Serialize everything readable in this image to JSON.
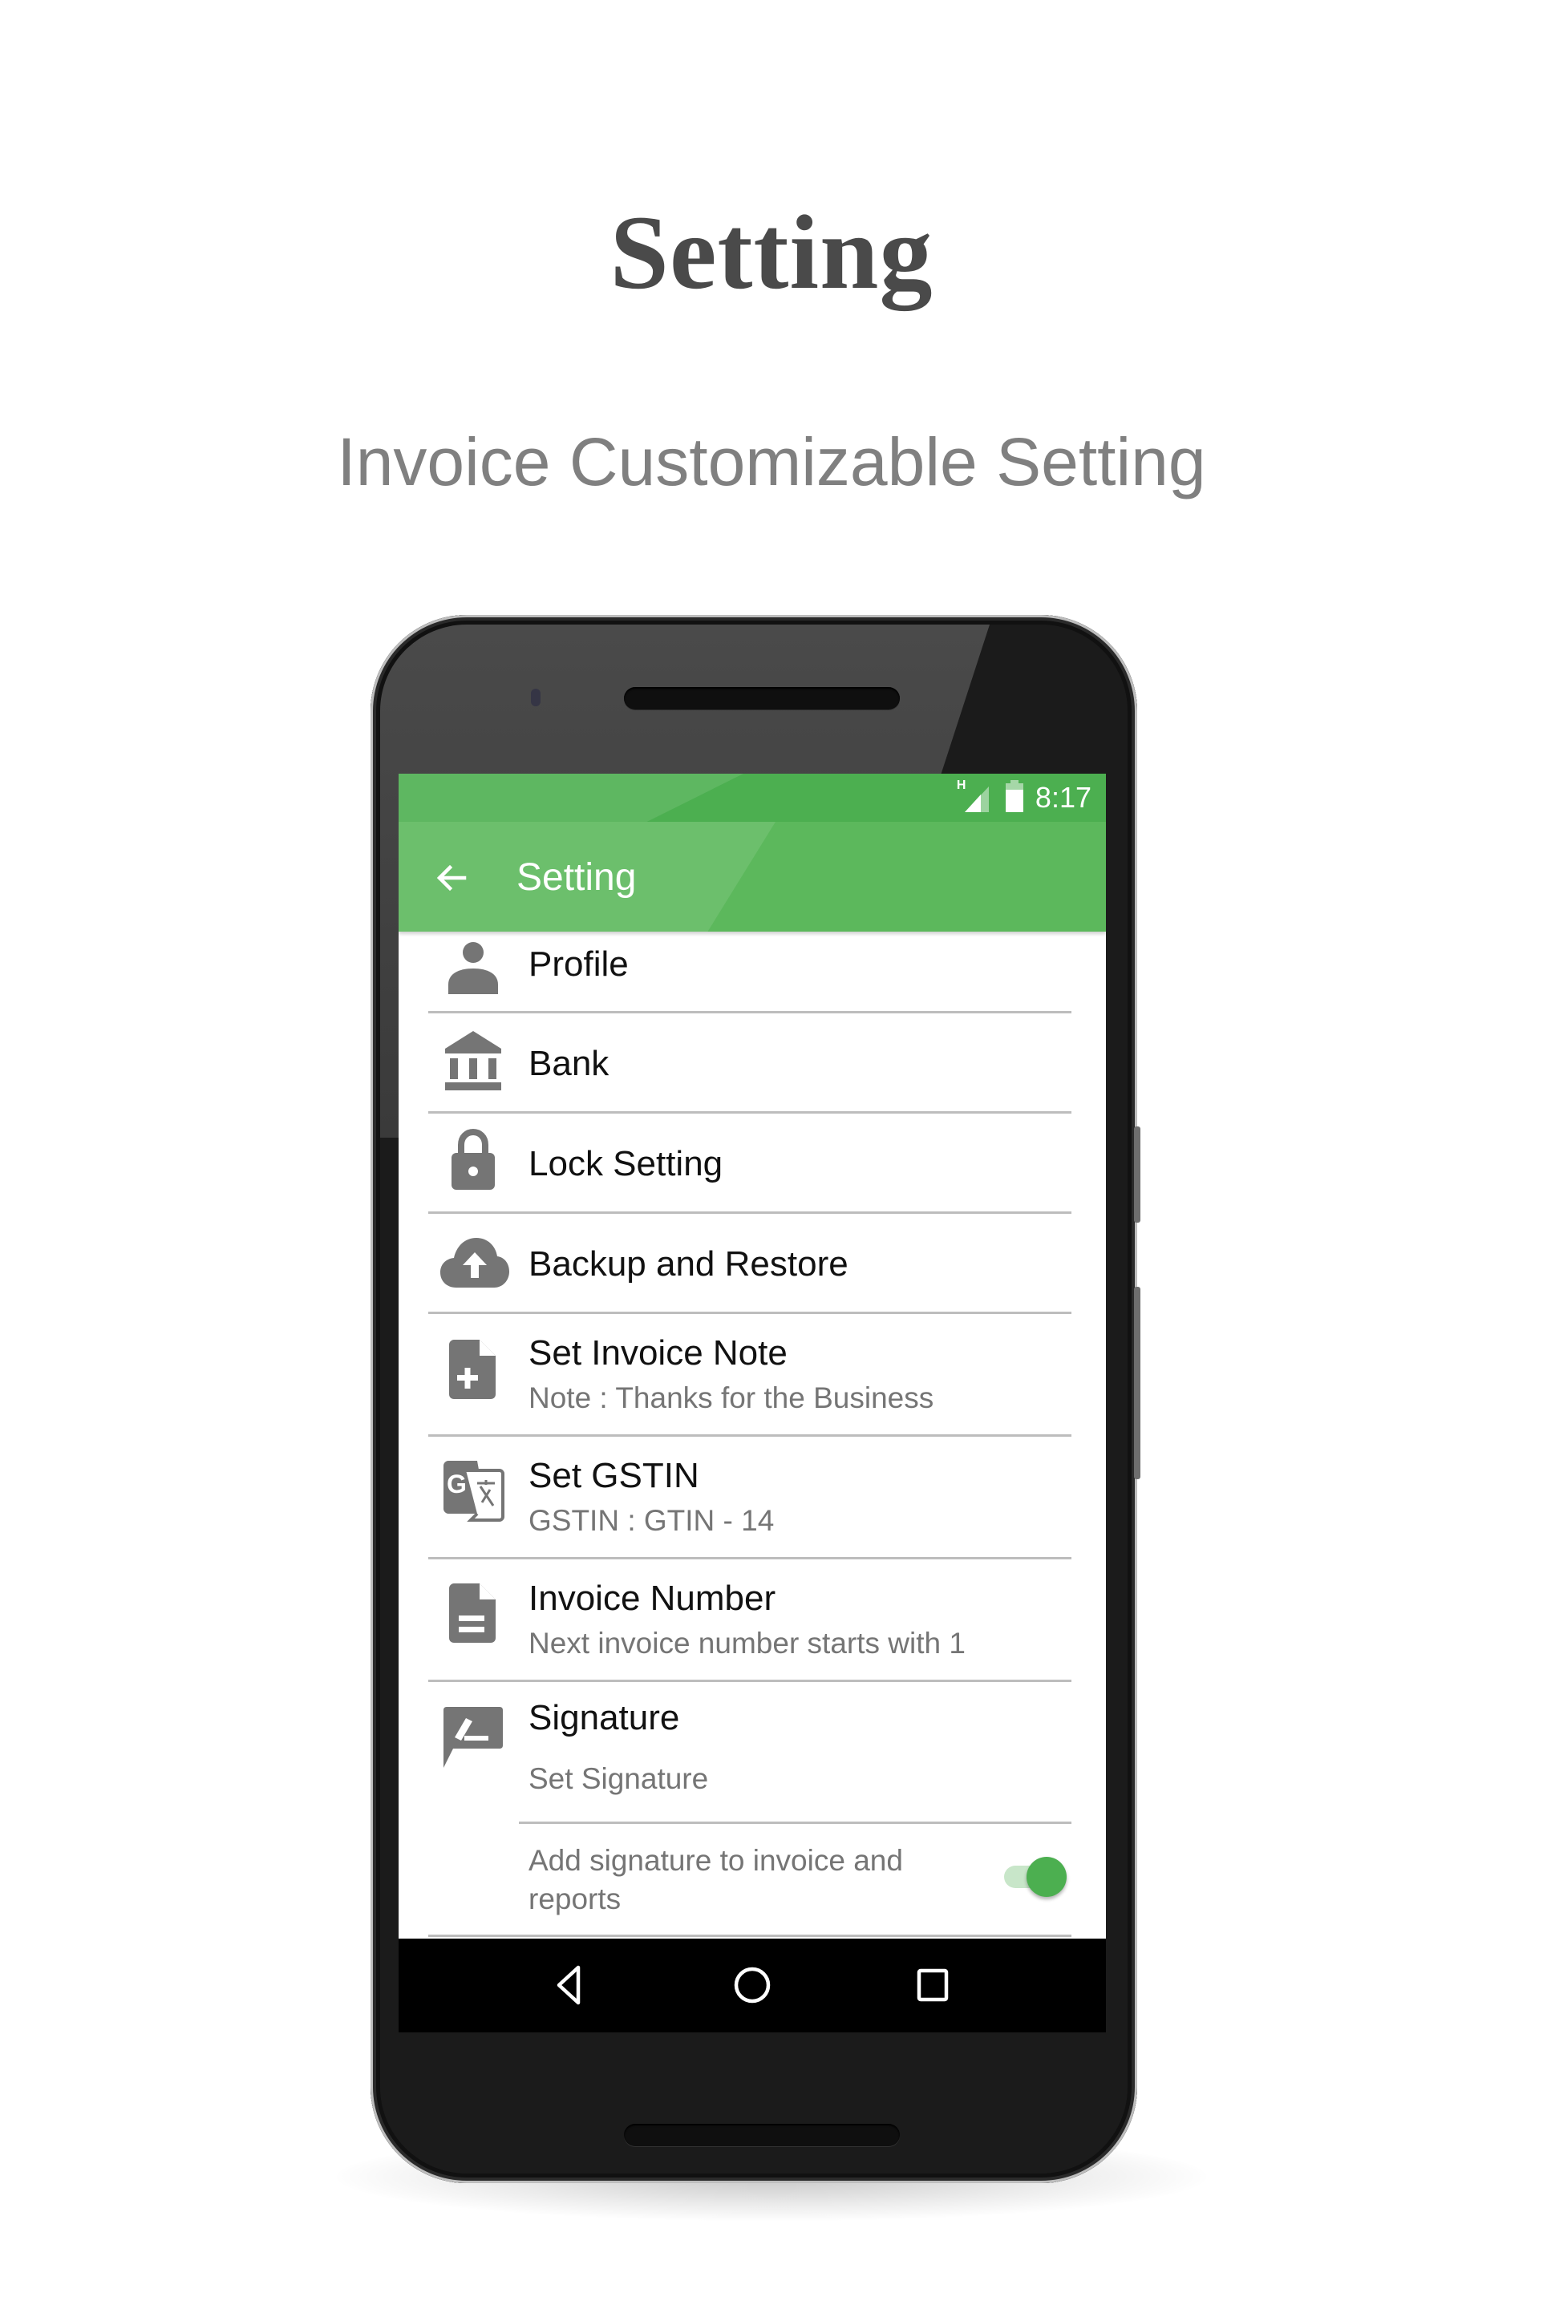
{
  "promo": {
    "headline": "Setting",
    "subheadline": "Invoice Customizable Setting"
  },
  "status_bar": {
    "network_label": "H",
    "signal_icon": "signal-icon",
    "battery_icon": "battery-icon",
    "time": "8:17"
  },
  "toolbar": {
    "back_icon": "arrow-left-icon",
    "title": "Setting"
  },
  "settings": {
    "items": [
      {
        "icon": "person-icon",
        "title": "Profile"
      },
      {
        "icon": "bank-icon",
        "title": "Bank"
      },
      {
        "icon": "lock-icon",
        "title": "Lock Setting"
      },
      {
        "icon": "cloud-upload-icon",
        "title": "Backup and Restore"
      },
      {
        "icon": "note-add-icon",
        "title": "Set Invoice Note",
        "subtitle": "Note : Thanks for the Business"
      },
      {
        "icon": "translate-icon",
        "title": "Set GSTIN",
        "subtitle": "GSTIN : GTIN - 14"
      },
      {
        "icon": "document-icon",
        "title": "Invoice Number",
        "subtitle": "Next invoice number starts with 1"
      },
      {
        "icon": "signature-icon",
        "title": "Signature",
        "subtitle": "Set Signature"
      }
    ],
    "signature_toggle": {
      "label_line1": "Add signature to invoice and",
      "label_line2": "reports",
      "enabled": true
    }
  },
  "nav_bar": {
    "back": "nav-back-icon",
    "home": "nav-home-icon",
    "recents": "nav-recents-icon"
  },
  "colors": {
    "primary": "#5cb85c",
    "primary_dark": "#4caf50",
    "toggle_track": "#c8e6c9",
    "icon_gray": "#757575"
  }
}
